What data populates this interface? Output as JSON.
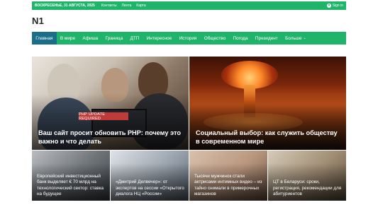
{
  "topbar": {
    "date": "ВОСКРЕСЕНЬЕ, 31 АВГУСТА, 2025",
    "links": [
      "Контакты",
      "Лента",
      "Карта"
    ],
    "signin": "Sign in"
  },
  "site": {
    "logo": "N1"
  },
  "nav": {
    "items": [
      "Главная",
      "В мире",
      "Афиша",
      "Граница",
      "ДТП",
      "Интересное",
      "История",
      "Общество",
      "Погода",
      "Президент"
    ],
    "more": "Больше"
  },
  "hero": {
    "left": {
      "badge": "PHP UPDATE REQUIRED",
      "title": "Ваш сайт просит обновить PHP: почему это важно и что делать"
    },
    "right": {
      "title": "Социальный выбор: как служить обществу в современном мире"
    }
  },
  "cards": [
    {
      "title": "Европейский инвестиционный банк выделяет € 70 млрд на технологический сектор: ставка на будущее"
    },
    {
      "title": "«Дмитрий Делвечер»: от экспертов на сессии «Открытого диалога НЦ «России»"
    },
    {
      "title": "Тысячи мужчинок стали актрисами интимных видео – из тайно снимали в примерочных магазинов"
    },
    {
      "title": "ЦТ в Беларуси: сроки, регистрация, рекомендации для абитуриентов"
    }
  ],
  "colors": {
    "brand": "#20b46b",
    "nav_active": "#1a6e8a",
    "badge": "#c03a3a"
  }
}
